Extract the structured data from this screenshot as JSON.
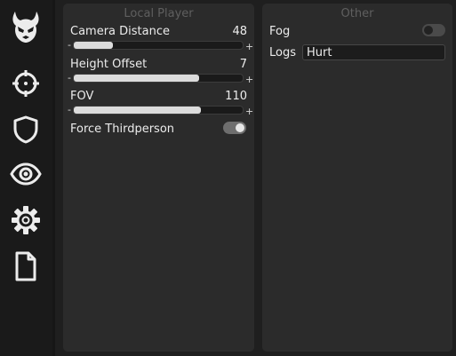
{
  "sidebar": {
    "icons": [
      "demon-logo-icon",
      "crosshair-icon",
      "shield-icon",
      "eye-icon",
      "gear-icon",
      "file-icon"
    ]
  },
  "local_player": {
    "title": "Local Player",
    "camera_distance": {
      "label": "Camera Distance",
      "value": "48",
      "fraction": 0.23,
      "minus": "-",
      "plus": "+"
    },
    "height_offset": {
      "label": "Height Offset",
      "value": "7",
      "fraction": 0.74,
      "minus": "-",
      "plus": "+"
    },
    "fov": {
      "label": "FOV",
      "value": "110",
      "fraction": 0.75,
      "minus": "-",
      "plus": "+"
    },
    "force_thirdperson": {
      "label": "Force Thirdperson",
      "enabled": true
    }
  },
  "other": {
    "title": "Other",
    "fog": {
      "label": "Fog",
      "enabled": false
    },
    "logs": {
      "label": "Logs",
      "value": "Hurt"
    }
  },
  "colors": {
    "panel": "#2b2b2b",
    "toggle_on_bg": "#6e6e6e",
    "toggle_on_knob": "#e6e6e6",
    "toggle_off_bg": "#4a4a4a",
    "toggle_off_knob": "#222222"
  }
}
